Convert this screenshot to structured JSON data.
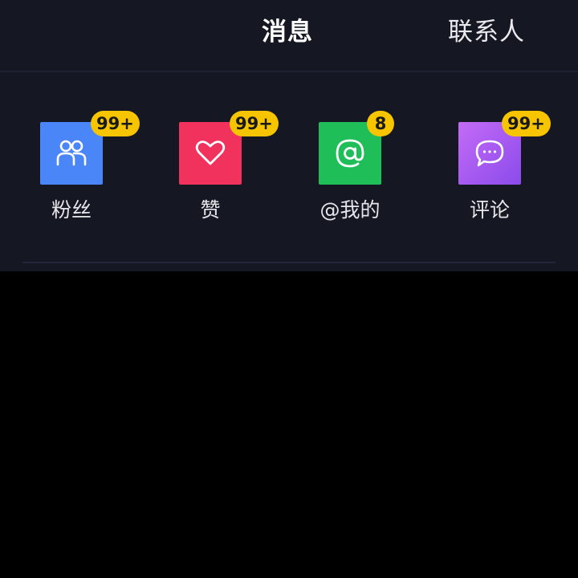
{
  "tabs": [
    {
      "label": "消息",
      "active": true
    },
    {
      "label": "联系人",
      "active": false
    }
  ],
  "entries": [
    {
      "label": "粉丝",
      "badge": "99+",
      "icon": "fans-icon",
      "color": "#4a86f7"
    },
    {
      "label": "赞",
      "badge": "99+",
      "icon": "heart-icon",
      "color": "#f0325c"
    },
    {
      "label": "@我的",
      "badge": "8",
      "icon": "at-icon",
      "color": "#1fbe59"
    },
    {
      "label": "评论",
      "badge": "99+",
      "icon": "comment-icon",
      "color": "#a058f0"
    }
  ],
  "colors": {
    "panel_bg": "#151722",
    "badge_bg": "#f7c400",
    "page_bg": "#000000"
  }
}
